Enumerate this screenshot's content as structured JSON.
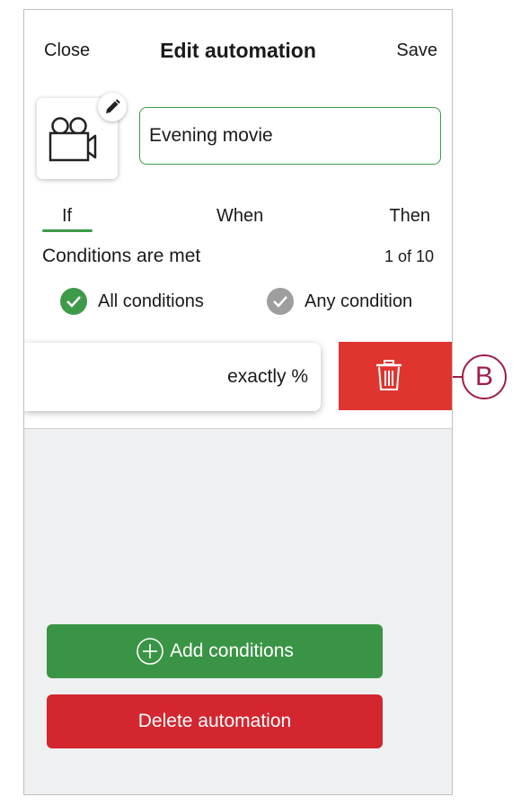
{
  "header": {
    "close_label": "Close",
    "title": "Edit automation",
    "save_label": "Save"
  },
  "automation": {
    "icon": "movie-camera-icon",
    "edit_icon": "pencil-icon",
    "name": "Evening movie"
  },
  "tabs": [
    {
      "label": "If",
      "active": true
    },
    {
      "label": "When",
      "active": false
    },
    {
      "label": "Then",
      "active": false
    }
  ],
  "conditions": {
    "title": "Conditions are met",
    "count": "1 of 10",
    "options": [
      {
        "label": "All conditions",
        "selected": true
      },
      {
        "label": "Any condition",
        "selected": false
      }
    ]
  },
  "rule": {
    "text": "exactly %",
    "delete_icon": "trash-icon"
  },
  "actions": {
    "add_label": "Add conditions",
    "delete_label": "Delete automation"
  },
  "annotation": {
    "label": "B"
  },
  "colors": {
    "accent_green": "#3d9a4a",
    "delete_red": "#e0342f",
    "danger_button": "#d3262f",
    "callout": "#9c1f47"
  }
}
